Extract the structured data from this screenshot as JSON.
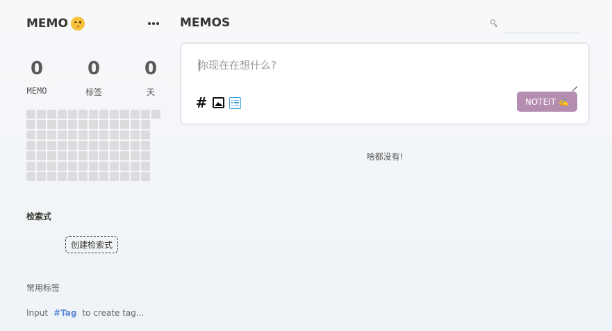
{
  "sidebar": {
    "app_name": "MEMO",
    "app_icon": "wink-face-icon",
    "stats": [
      {
        "value": "0",
        "label": "MEMO"
      },
      {
        "value": "0",
        "label": "标签"
      },
      {
        "value": "0",
        "label": "天"
      }
    ],
    "heatmap": {
      "rows": 7,
      "columns": 13,
      "last_column_filled_cells": 1,
      "empty_color": "#dcdcde"
    },
    "queries_title": "检索式",
    "create_query_label": "创建检索式",
    "tags_title": "常用标签",
    "tag_hint": {
      "prefix": "Input",
      "accent": "#Tag",
      "suffix": "to create tag..."
    }
  },
  "main": {
    "title": "MEMOS",
    "search_placeholder": "",
    "editor_placeholder": "你现在在想什么?",
    "tools": [
      "hash-icon",
      "image-icon",
      "list-icon"
    ],
    "submit_label": "NOTEIT",
    "submit_emoji": "✍️",
    "empty_text": "啥都没有!"
  },
  "colors": {
    "accent_button": "#b58db0",
    "tag_accent": "#5a87d6",
    "list_icon": "#3b9fd8"
  }
}
